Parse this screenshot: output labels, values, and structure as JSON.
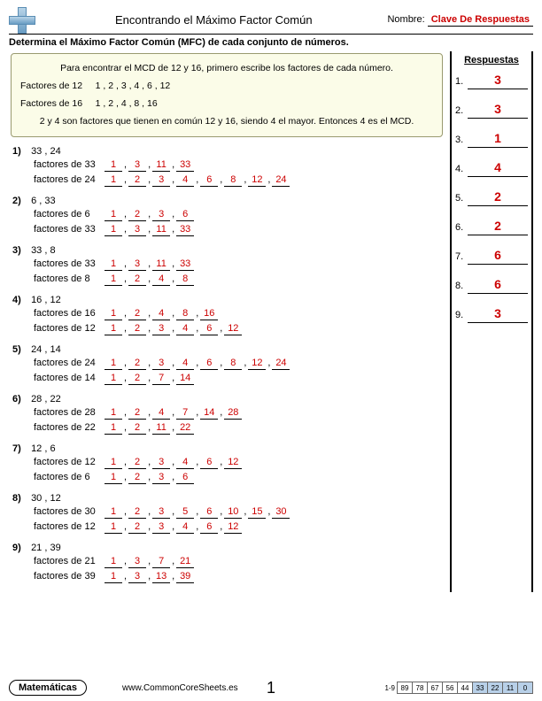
{
  "header": {
    "title": "Encontrando el Máximo Factor Común",
    "name_label": "Nombre:",
    "name_value": "Clave De Respuestas"
  },
  "instructions": "Determina el Máximo Factor Común (MFC) de cada conjunto de números.",
  "answers_header": "Respuestas",
  "example": {
    "intro": "Para encontrar el MCD de 12 y 16, primero escribe los factores de cada número.",
    "f12_label": "Factores de 12",
    "f12": "1  ,  2  ,  3  ,  4  ,  6  , 12",
    "f16_label": "Factores de 16",
    "f16": "1  ,  2  ,  4  ,  8  , 16",
    "conclusion": "2 y 4 son factores que tienen en común 12 y 16, siendo 4 el mayor. Entonces 4 es el MCD."
  },
  "problems": [
    {
      "n": "1",
      "pair": "33 , 24",
      "lines": [
        {
          "label": "factores de 33",
          "vals": [
            "1",
            "3",
            "11",
            "33"
          ]
        },
        {
          "label": "factores de 24",
          "vals": [
            "1",
            "2",
            "3",
            "4",
            "6",
            "8",
            "12",
            "24"
          ]
        }
      ]
    },
    {
      "n": "2",
      "pair": "6 , 33",
      "lines": [
        {
          "label": "factores de 6",
          "vals": [
            "1",
            "2",
            "3",
            "6"
          ]
        },
        {
          "label": "factores de 33",
          "vals": [
            "1",
            "3",
            "11",
            "33"
          ]
        }
      ]
    },
    {
      "n": "3",
      "pair": "33 , 8",
      "lines": [
        {
          "label": "factores de 33",
          "vals": [
            "1",
            "3",
            "11",
            "33"
          ]
        },
        {
          "label": "factores de 8",
          "vals": [
            "1",
            "2",
            "4",
            "8"
          ]
        }
      ]
    },
    {
      "n": "4",
      "pair": "16 , 12",
      "lines": [
        {
          "label": "factores de 16",
          "vals": [
            "1",
            "2",
            "4",
            "8",
            "16"
          ]
        },
        {
          "label": "factores de 12",
          "vals": [
            "1",
            "2",
            "3",
            "4",
            "6",
            "12"
          ]
        }
      ]
    },
    {
      "n": "5",
      "pair": "24 , 14",
      "lines": [
        {
          "label": "factores de 24",
          "vals": [
            "1",
            "2",
            "3",
            "4",
            "6",
            "8",
            "12",
            "24"
          ]
        },
        {
          "label": "factores de 14",
          "vals": [
            "1",
            "2",
            "7",
            "14"
          ]
        }
      ]
    },
    {
      "n": "6",
      "pair": "28 , 22",
      "lines": [
        {
          "label": "factores de 28",
          "vals": [
            "1",
            "2",
            "4",
            "7",
            "14",
            "28"
          ]
        },
        {
          "label": "factores de 22",
          "vals": [
            "1",
            "2",
            "11",
            "22"
          ]
        }
      ]
    },
    {
      "n": "7",
      "pair": "12 , 6",
      "lines": [
        {
          "label": "factores de 12",
          "vals": [
            "1",
            "2",
            "3",
            "4",
            "6",
            "12"
          ]
        },
        {
          "label": "factores de 6",
          "vals": [
            "1",
            "2",
            "3",
            "6"
          ]
        }
      ]
    },
    {
      "n": "8",
      "pair": "30 , 12",
      "lines": [
        {
          "label": "factores de 30",
          "vals": [
            "1",
            "2",
            "3",
            "5",
            "6",
            "10",
            "15",
            "30"
          ]
        },
        {
          "label": "factores de 12",
          "vals": [
            "1",
            "2",
            "3",
            "4",
            "6",
            "12"
          ]
        }
      ]
    },
    {
      "n": "9",
      "pair": "21 , 39",
      "lines": [
        {
          "label": "factores de 21",
          "vals": [
            "1",
            "3",
            "7",
            "21"
          ]
        },
        {
          "label": "factores de 39",
          "vals": [
            "1",
            "3",
            "13",
            "39"
          ]
        }
      ]
    }
  ],
  "answers": [
    "3",
    "3",
    "1",
    "4",
    "2",
    "2",
    "6",
    "6",
    "3"
  ],
  "footer": {
    "subject": "Matemáticas",
    "site": "www.CommonCoreSheets.es",
    "page": "1",
    "scale_label": "1-9",
    "scale": [
      "89",
      "78",
      "67",
      "56",
      "44",
      "33",
      "22",
      "11",
      "0"
    ],
    "highlight_from": 5
  }
}
